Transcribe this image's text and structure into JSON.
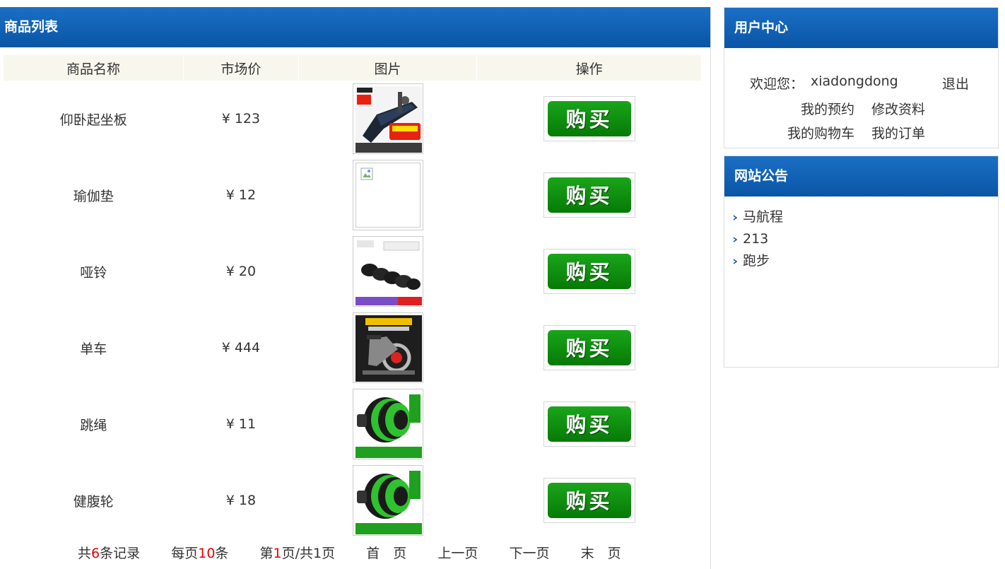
{
  "product_list": {
    "title": "商品列表",
    "columns": [
      "商品名称",
      "市场价",
      "图片",
      "操作"
    ],
    "rows": [
      {
        "name": "仰卧起坐板",
        "price": "¥ 123",
        "image": "sit-up-bench-image",
        "buy_label": "购买"
      },
      {
        "name": "瑜伽垫",
        "price": "¥ 12",
        "image": "broken-image",
        "buy_label": "购买"
      },
      {
        "name": "哑铃",
        "price": "¥ 20",
        "image": "dumbbell-image",
        "buy_label": "购买"
      },
      {
        "name": "单车",
        "price": "¥ 444",
        "image": "exercise-bike-image",
        "buy_label": "购买"
      },
      {
        "name": "跳绳",
        "price": "¥ 11",
        "image": "ab-wheel-image",
        "buy_label": "购买"
      },
      {
        "name": "健腹轮",
        "price": "¥ 18",
        "image": "ab-wheel-image",
        "buy_label": "购买"
      }
    ],
    "pager": {
      "total_prefix": "共",
      "total": "6",
      "total_suffix": "条记录",
      "per_prefix": "每页",
      "per": "10",
      "per_suffix": "条",
      "page_prefix": "第",
      "page": "1",
      "page_suffix": "页/共1页",
      "first": "首　页",
      "prev": "上一页",
      "next": "下一页",
      "last": "末　页"
    }
  },
  "user_center": {
    "title": "用户中心",
    "welcome_label": "欢迎您：",
    "username": "xiadongdong",
    "logout": "退出",
    "links": [
      "我的预约",
      "修改资料",
      "我的购物车",
      "我的订单"
    ]
  },
  "notice": {
    "title": "网站公告",
    "items": [
      "马航程",
      "213",
      "跑步"
    ]
  },
  "colors": {
    "header_blue": "#0a55a6",
    "buy_green": "#067a06",
    "highlight_red": "#e60000"
  }
}
